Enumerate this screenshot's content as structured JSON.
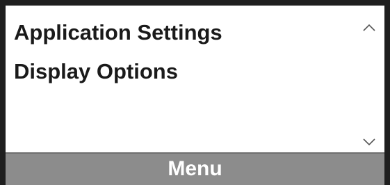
{
  "menu": {
    "items": [
      {
        "label": "Application Settings"
      },
      {
        "label": "Display Options"
      }
    ]
  },
  "scroll": {
    "up_icon": "chevron-up-icon",
    "down_icon": "chevron-down-icon"
  },
  "softkey": {
    "label": "Menu",
    "background": "#8c8c8c",
    "text_color": "#ffffff"
  },
  "colors": {
    "frame": "#1f1f1f",
    "text": "#1a1a1a",
    "screen": "#ffffff"
  }
}
